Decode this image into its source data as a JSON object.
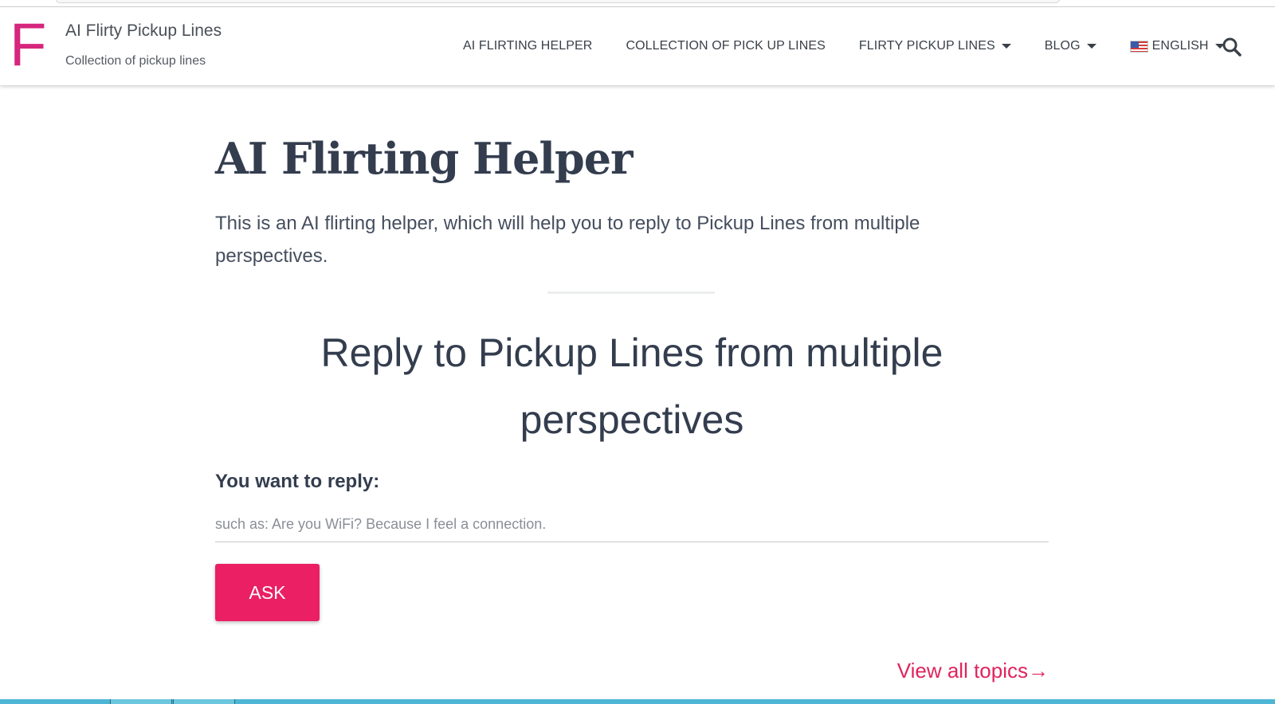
{
  "header": {
    "logo_letter": "F",
    "site_title": "AI Flirty Pickup Lines",
    "site_tagline": "Collection of pickup lines",
    "nav": {
      "items": [
        {
          "label": "AI FLIRTING HELPER"
        },
        {
          "label": "COLLECTION OF PICK UP LINES"
        },
        {
          "label": "FLIRTY PICKUP LINES"
        },
        {
          "label": "BLOG"
        },
        {
          "label": "ENGLISH"
        }
      ]
    },
    "search_icon": "search-icon"
  },
  "main": {
    "page_title": "AI Flirting Helper",
    "intro": "This is an AI flirting helper, which will help you to reply to Pickup Lines from multiple perspectives.",
    "section_title": "Reply to Pickup Lines from multiple perspectives",
    "field_label": "You want to reply:",
    "input": {
      "value": "",
      "placeholder": "such as: Are you WiFi? Because I feel a connection."
    },
    "ask_label": "ASK",
    "view_all_label": "View all topics→"
  },
  "colors": {
    "brand": "#d6267d",
    "button": "#eb1f63",
    "link": "#e0245e",
    "text": "#333d4e"
  }
}
